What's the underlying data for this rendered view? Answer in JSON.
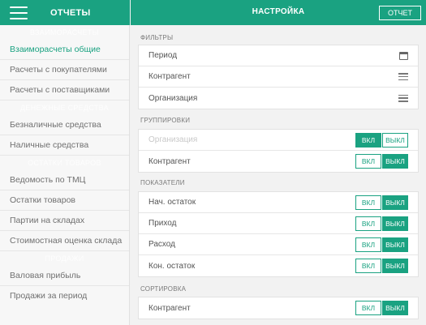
{
  "header": {
    "left_title": "ОТЧЕТЫ",
    "right_title": "НАСТРОЙКА",
    "report_button": "ОТЧЕТ"
  },
  "sidebar": {
    "groups": [
      {
        "title": "ВЗАИМОРАСЧЕТЫ",
        "items": [
          "Взаиморасчеты общие",
          "Расчеты с покупателями",
          "Расчеты с поставщиками"
        ]
      },
      {
        "title": "ДЕНЕЖНЫЕ СРЕДСТВА",
        "items": [
          "Безналичные средства",
          "Наличные средства"
        ]
      },
      {
        "title": "ОСТАТКИ ТОВАРОВ",
        "items": [
          "Ведомость по ТМЦ",
          "Остатки товаров",
          "Партии на складах",
          "Стоимостная оценка склада"
        ]
      },
      {
        "title": "ПРОДАЖИ",
        "items": [
          "Валовая прибыль",
          "Продажи за период"
        ]
      }
    ],
    "active_item": "Взаиморасчеты общие"
  },
  "main": {
    "filters": {
      "label": "ФИЛЬТРЫ",
      "rows": [
        {
          "text": "Период",
          "icon": "calendar-icon"
        },
        {
          "text": "Контрагент",
          "icon": "menu-lines-icon"
        },
        {
          "text": "Организация",
          "icon": "menu-lines-icon"
        }
      ]
    },
    "groupings": {
      "label": "ГРУППИРОВКИ",
      "rows": [
        {
          "text": "Организация",
          "dimmed": true,
          "on_label": "ВКЛ",
          "off_label": "ВЫКЛ",
          "state": "on"
        },
        {
          "text": "Контрагент",
          "dimmed": false,
          "on_label": "ВКЛ",
          "off_label": "ВЫКЛ",
          "state": "off"
        }
      ]
    },
    "indicators": {
      "label": "ПОКАЗАТЕЛИ",
      "rows": [
        {
          "text": "Нач. остаток",
          "on_label": "ВКЛ",
          "off_label": "ВЫКЛ",
          "state": "off"
        },
        {
          "text": "Приход",
          "on_label": "ВКЛ",
          "off_label": "ВЫКЛ",
          "state": "off"
        },
        {
          "text": "Расход",
          "on_label": "ВКЛ",
          "off_label": "ВЫКЛ",
          "state": "off"
        },
        {
          "text": "Кон. остаток",
          "on_label": "ВКЛ",
          "off_label": "ВЫКЛ",
          "state": "off"
        }
      ]
    },
    "sorting": {
      "label": "СОРТИРОВКА",
      "rows": [
        {
          "text": "Контрагент",
          "on_label": "ВКЛ",
          "off_label": "ВЫКЛ",
          "state": "off"
        }
      ]
    }
  },
  "colors": {
    "accent": "#1aa281"
  }
}
